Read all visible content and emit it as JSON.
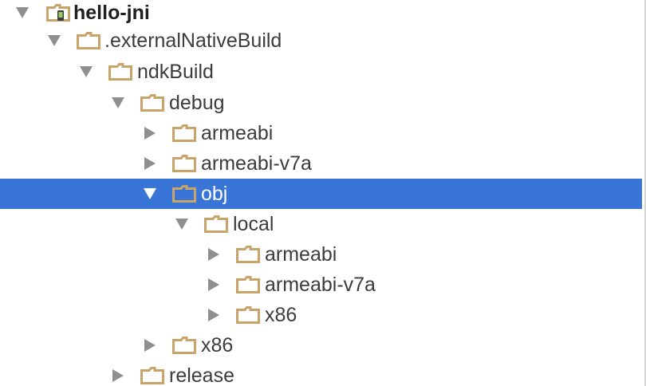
{
  "project_tree": {
    "root": {
      "label": "hello-jni",
      "expanded": true,
      "icon": "module-folder-icon"
    },
    "nodes": [
      {
        "id": "externalNativeBuild",
        "label": ".externalNativeBuild",
        "expanded": true,
        "icon": "folder-icon"
      },
      {
        "id": "ndkBuild",
        "label": "ndkBuild",
        "expanded": true,
        "icon": "folder-icon"
      },
      {
        "id": "debug",
        "label": "debug",
        "expanded": true,
        "icon": "folder-icon"
      },
      {
        "id": "debug-armeabi",
        "label": "armeabi",
        "expanded": false,
        "icon": "folder-icon"
      },
      {
        "id": "debug-armeabi-v7a",
        "label": "armeabi-v7a",
        "expanded": false,
        "icon": "folder-icon"
      },
      {
        "id": "obj",
        "label": "obj",
        "expanded": true,
        "selected": true,
        "icon": "folder-icon"
      },
      {
        "id": "local",
        "label": "local",
        "expanded": true,
        "icon": "folder-icon"
      },
      {
        "id": "local-armeabi",
        "label": "armeabi",
        "expanded": false,
        "icon": "folder-icon"
      },
      {
        "id": "local-armeabi-v7a",
        "label": "armeabi-v7a",
        "expanded": false,
        "icon": "folder-icon"
      },
      {
        "id": "local-x86",
        "label": "x86",
        "expanded": false,
        "icon": "folder-icon"
      },
      {
        "id": "debug-x86",
        "label": "x86",
        "expanded": false,
        "icon": "folder-icon"
      },
      {
        "id": "release",
        "label": "release",
        "expanded": false,
        "icon": "folder-icon"
      }
    ]
  },
  "colors": {
    "selection": "#3875d7",
    "folder": "#c8a46a",
    "arrow": "#8f8f8f",
    "text": "#3c3c3c"
  }
}
